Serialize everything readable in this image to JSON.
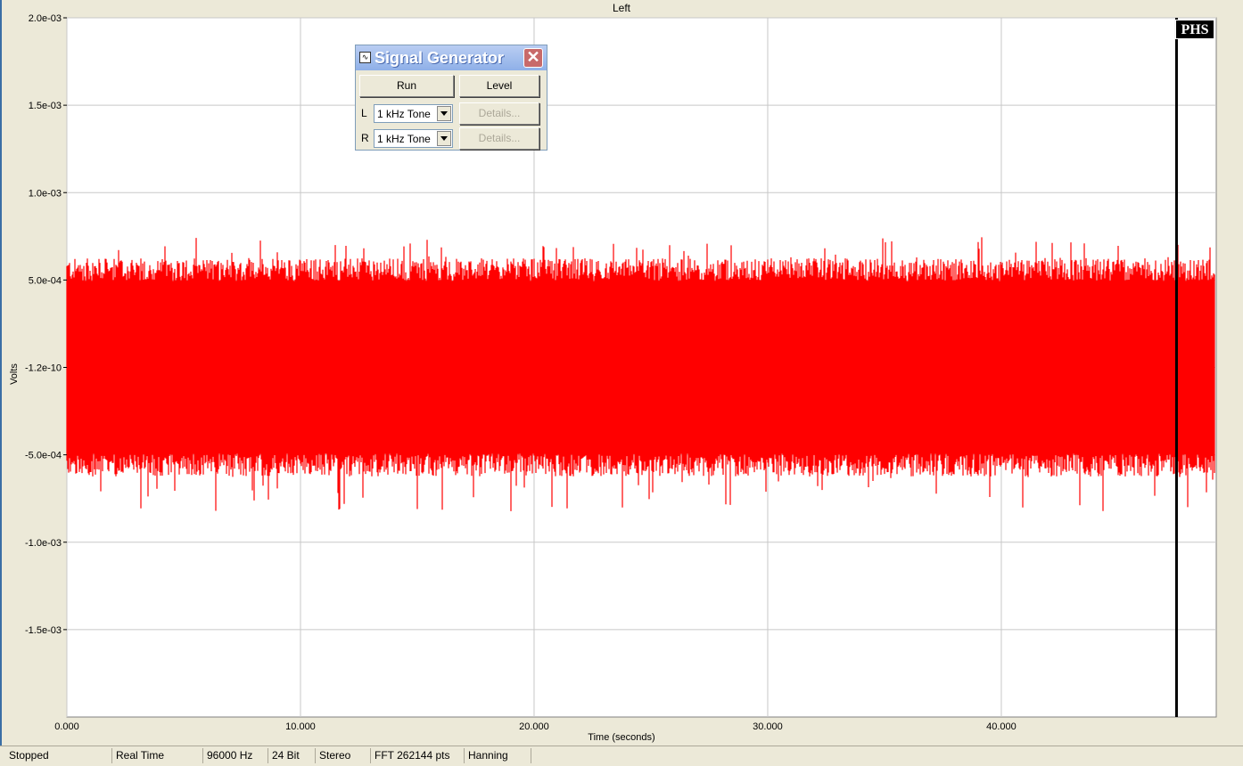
{
  "window": {
    "plot_title": "Left"
  },
  "chart_data": {
    "type": "line",
    "title": "Left",
    "xlabel": "Time (seconds)",
    "ylabel": "Volts",
    "xlim": [
      0,
      49.2
    ],
    "ylim": [
      -0.002,
      0.002
    ],
    "x_ticks": [
      "0.000",
      "10.000",
      "20.000",
      "30.000",
      "40.000"
    ],
    "x_tick_values": [
      0,
      10,
      20,
      30,
      40
    ],
    "y_ticks": [
      "2.0e-03",
      "1.5e-03",
      "1.0e-03",
      "5.0e-04",
      "-1.2e-10",
      "-5.0e-04",
      "-1.0e-03",
      "-1.5e-03"
    ],
    "y_tick_values": [
      0.002,
      0.0015,
      0.001,
      0.0005,
      0,
      -0.0005,
      -0.001,
      -0.0015
    ],
    "grid": true,
    "series": [
      {
        "color": "#ff0000",
        "description_envelope_upper": 0.00052,
        "envelope_lower": -0.00052,
        "peak_max": 0.00075,
        "peak_min": -0.00083
      }
    ],
    "cursor_x": 47.5,
    "cursor_label": "PHS"
  },
  "signal_generator": {
    "title": "Signal Generator",
    "run_label": "Run",
    "level_label": "Level",
    "left_channel_label": "L",
    "right_channel_label": "R",
    "left_selection": "1 kHz Tone",
    "right_selection": "1 kHz Tone",
    "details_label": "Details..."
  },
  "statusbar": {
    "state": "Stopped",
    "mode": "Real Time",
    "sample_rate": "96000 Hz",
    "bit_depth": "24 Bit",
    "channels": "Stereo",
    "fft": "FFT 262144 pts",
    "window": "Hanning"
  },
  "colors": {
    "background": "#ece9d8",
    "plot_background": "#ffffff",
    "grid": "#c8c8c8",
    "trace": "#ff0000",
    "cursor": "#000000"
  }
}
